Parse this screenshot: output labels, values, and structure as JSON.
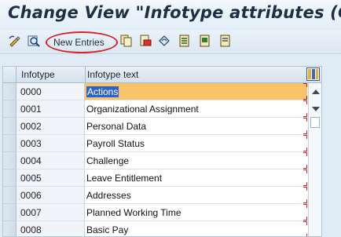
{
  "window": {
    "title": "Change View \"Infotype attributes (Customer version)\": Overview"
  },
  "toolbar": {
    "icons": [
      "display-change-icon",
      "find-icon",
      "copy-as-icon",
      "delete-icon",
      "undo-change-icon",
      "select-all-icon",
      "select-block-icon",
      "deselect-all-icon"
    ],
    "new_entries_label": "New Entries",
    "highlight_color": "#d2262a"
  },
  "table": {
    "columns": [
      "Infotype",
      "Infotype text"
    ],
    "settings_icon": "table-settings-icon",
    "rows": [
      {
        "code": "0000",
        "text": "Actions",
        "active": true
      },
      {
        "code": "0001",
        "text": "Organizational Assignment"
      },
      {
        "code": "0002",
        "text": "Personal Data"
      },
      {
        "code": "0003",
        "text": "Payroll Status"
      },
      {
        "code": "0004",
        "text": "Challenge"
      },
      {
        "code": "0005",
        "text": "Leave Entitlement"
      },
      {
        "code": "0006",
        "text": "Addresses"
      },
      {
        "code": "0007",
        "text": "Planned Working Time"
      },
      {
        "code": "0008",
        "text": "Basic Pay"
      }
    ]
  }
}
